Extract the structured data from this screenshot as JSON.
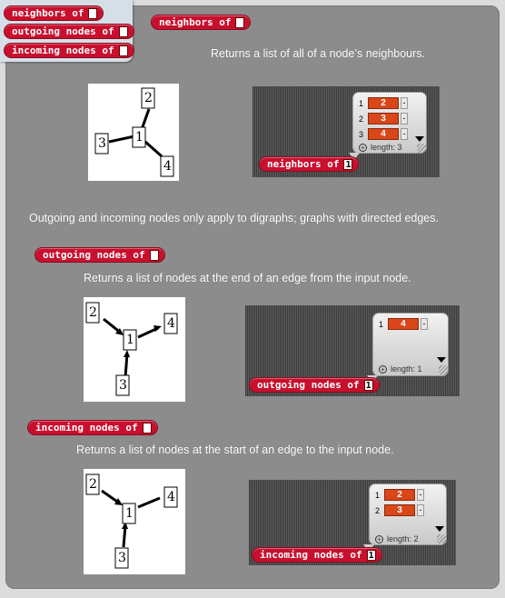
{
  "palette": {
    "blocks": [
      "neighbors of",
      "outgoing nodes of",
      "incoming nodes of"
    ]
  },
  "sections": {
    "neighbors": {
      "header_block": "neighbors of",
      "description": "Returns a list of all of a node’s neighbours.",
      "graph_nodes": [
        "1",
        "2",
        "3",
        "4"
      ],
      "result": {
        "items": [
          {
            "index": "1",
            "value": "2"
          },
          {
            "index": "2",
            "value": "3"
          },
          {
            "index": "3",
            "value": "4"
          }
        ],
        "length_label": "length: 3",
        "block_label": "neighbors of",
        "block_input": "1"
      }
    },
    "digraph_note": "Outgoing and incoming nodes only apply to digraphs; graphs with directed edges.",
    "outgoing": {
      "header_block": "outgoing nodes of",
      "description": "Returns a list of nodes at the end of an edge from the input node.",
      "graph_nodes": [
        "1",
        "2",
        "3",
        "4"
      ],
      "result": {
        "items": [
          {
            "index": "1",
            "value": "4"
          }
        ],
        "length_label": "length: 1",
        "block_label": "outgoing nodes of",
        "block_input": "1"
      }
    },
    "incoming": {
      "header_block": "incoming nodes of",
      "description": "Returns a list of nodes at the start of an edge to the input node.",
      "graph_nodes": [
        "1",
        "2",
        "3",
        "4"
      ],
      "result": {
        "items": [
          {
            "index": "1",
            "value": "2"
          },
          {
            "index": "2",
            "value": "3"
          }
        ],
        "length_label": "length: 2",
        "block_label": "incoming nodes of",
        "block_input": "1"
      }
    }
  },
  "list_item_dash": "-",
  "plus_glyph": "+",
  "colors": {
    "block_red": "#c8102e",
    "list_value_orange": "#d9461a",
    "panel_gray": "#8c8c8c"
  }
}
